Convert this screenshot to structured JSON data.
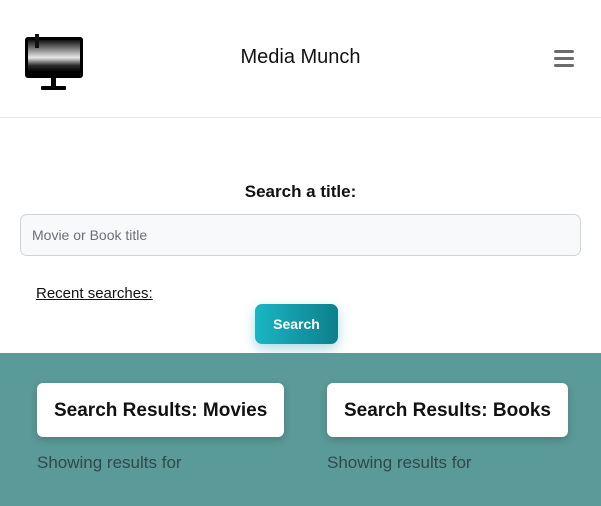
{
  "header": {
    "title": "Media Munch",
    "logo_icon": "monitor-icon",
    "menu_icon": "hamburger-menu-icon"
  },
  "search": {
    "label": "Search a title:",
    "input_value": "",
    "placeholder": "Movie or Book title",
    "recent_label": "Recent searches:",
    "button_label": "Search"
  },
  "results": {
    "movies_title": "Search Results: Movies",
    "movies_text": "Showing results for",
    "books_title": "Search Results: Books",
    "books_text": "Showing results for"
  },
  "colors": {
    "results_background": "#5a9a98",
    "button_gradient_start": "#19b6c3",
    "button_gradient_end": "#0d7f8c"
  }
}
